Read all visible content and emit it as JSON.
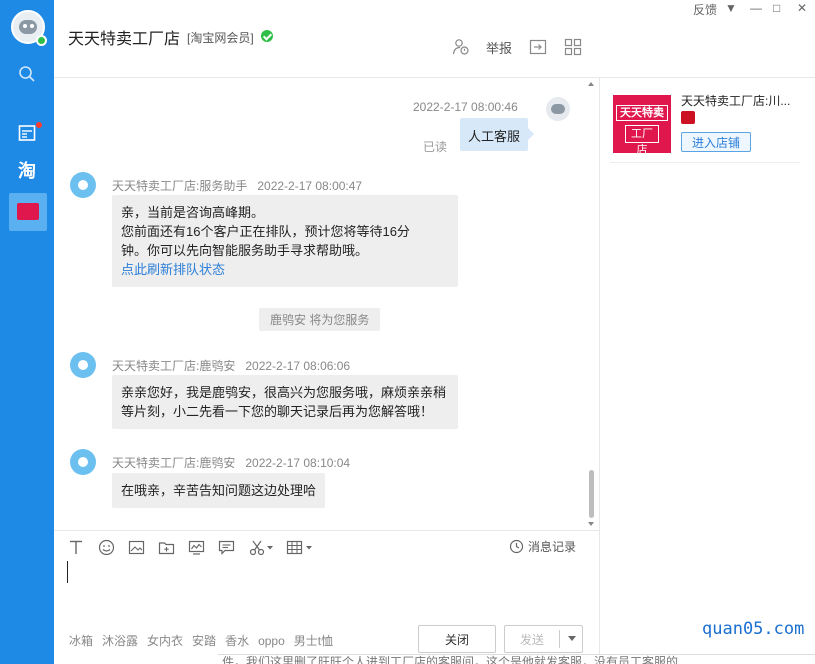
{
  "header": {
    "shop_title": "天天特卖工厂店",
    "member_tag": "[淘宝网会员]",
    "report_label": "举报",
    "feedback_label": "反馈",
    "window_controls": [
      "▼",
      "—",
      "□",
      "✕"
    ]
  },
  "sidebar": {
    "items": [
      {
        "name": "search",
        "icon": "search-icon"
      },
      {
        "name": "apps",
        "icon": "app-icon",
        "has_dot": true
      },
      {
        "name": "taobao",
        "label": "淘"
      },
      {
        "name": "shop",
        "icon": "shop-icon",
        "active": true
      }
    ]
  },
  "chat": {
    "self_message": {
      "time": "2022-2-17 08:00:46",
      "text": "人工客服",
      "read": "已读"
    },
    "messages": [
      {
        "sender": "天天特卖工厂店:服务助手",
        "time": "2022-2-17 08:00:47",
        "lines": [
          "亲，当前是咨询高峰期。",
          "您前面还有16个客户正在排队，预计您将等待16分",
          "钟。你可以先向智能服务助手寻求帮助哦。"
        ],
        "link": "点此刷新排队状态"
      },
      {
        "sender": "天天特卖工厂店:鹿鸮安",
        "time": "2022-2-17 08:06:06",
        "lines": [
          "亲亲您好，我是鹿鸮安，很高兴为您服务哦，麻烦亲亲稍",
          "等片刻，小二先看一下您的聊天记录后再为您解答哦！"
        ]
      },
      {
        "sender": "天天特卖工厂店:鹿鸮安",
        "time": "2022-2-17 08:10:04",
        "lines": [
          "在哦亲，辛苦告知问题这边处理哈"
        ]
      }
    ],
    "system_notice": "鹿鸮安 将为您服务"
  },
  "input": {
    "history_label": "消息记录",
    "quick_phrases": [
      "冰箱",
      "沐浴露",
      "女内衣",
      "安踏",
      "香水",
      "oppo",
      "男士t恤"
    ],
    "close_label": "关闭",
    "send_label": "发送"
  },
  "right_panel": {
    "shop_name": "天天特卖工厂店:川...",
    "logo_line1": "天天特卖",
    "logo_line2": "工厂店",
    "enter_label": "进入店铺"
  },
  "watermark": "quan05.com",
  "background_text": "件，我们这里删了旺旺个人进到工厂店的客服间，这个是他就发客服，没有员工客服的"
}
